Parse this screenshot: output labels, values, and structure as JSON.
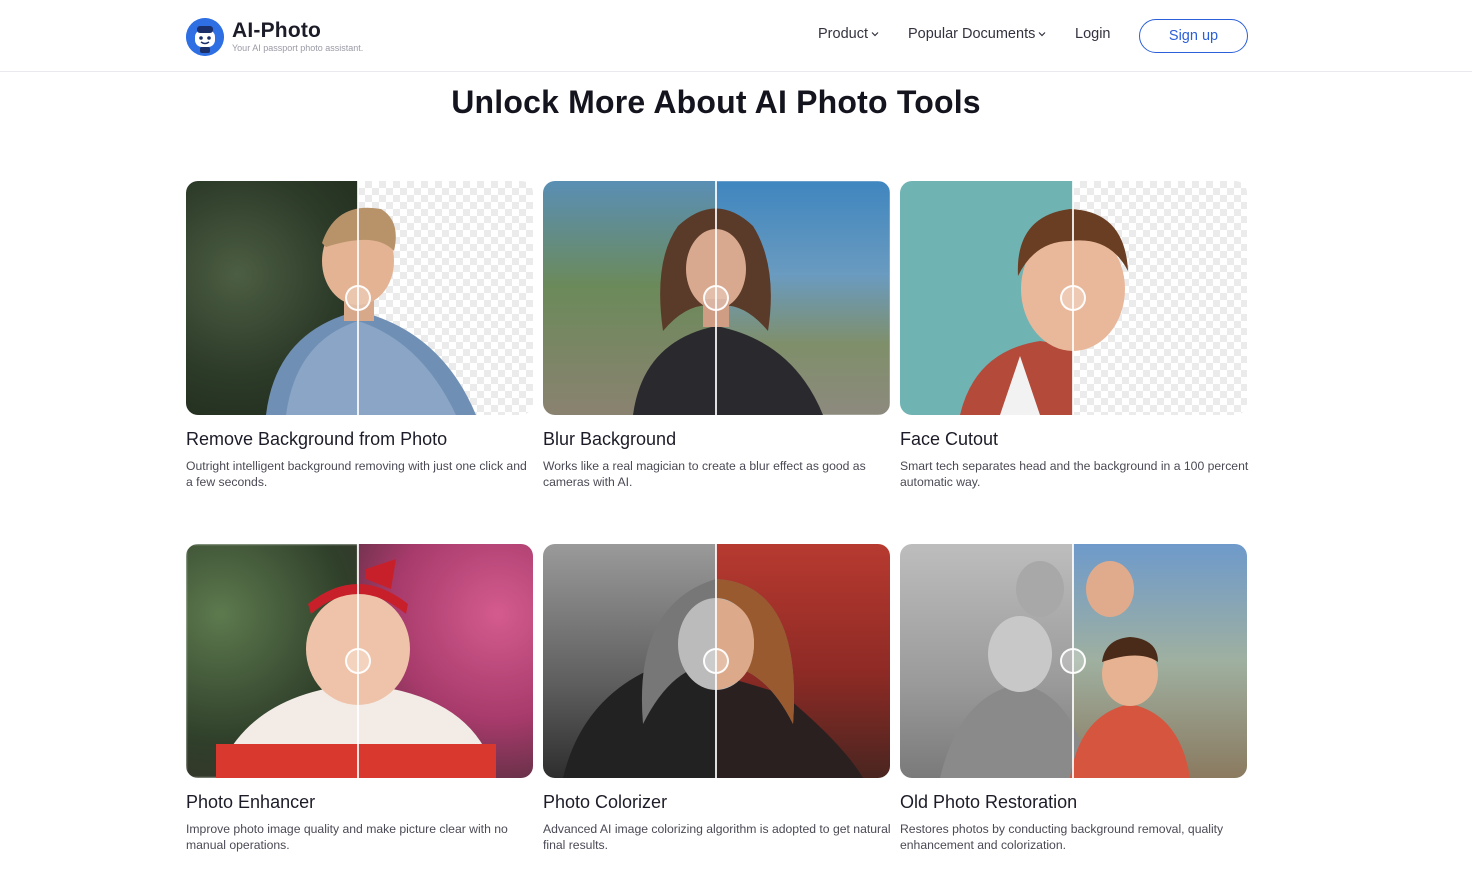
{
  "header": {
    "logo_title": "AI-Photo",
    "logo_tagline": "Your AI passport photo assistant.",
    "nav": [
      {
        "label": "Product",
        "has_dropdown": true
      },
      {
        "label": "Popular Documents",
        "has_dropdown": true
      },
      {
        "label": "Login",
        "has_dropdown": false
      }
    ],
    "signup_label": "Sign up"
  },
  "main": {
    "title": "Unlock More About AI Photo Tools",
    "tools": [
      {
        "title": "Remove Background from Photo",
        "description": "Outright intelligent background removing with just one click and a few seconds."
      },
      {
        "title": "Blur Background",
        "description": "Works like a real magician to create a blur effect as good as cameras with AI."
      },
      {
        "title": "Face Cutout",
        "description": "Smart tech separates head and the background in a 100 percent automatic way."
      },
      {
        "title": "Photo Enhancer",
        "description": "Improve photo image quality and make picture clear with no manual operations."
      },
      {
        "title": "Photo Colorizer",
        "description": "Advanced AI image colorizing algorithm is adopted to get natural final results."
      },
      {
        "title": "Old Photo Restoration",
        "description": "Restores photos by conducting background removal, quality enhancement and colorization."
      }
    ]
  },
  "colors": {
    "accent": "#2b5fd9",
    "logo_blue": "#2f6fe4",
    "text": "#1c1c28"
  }
}
